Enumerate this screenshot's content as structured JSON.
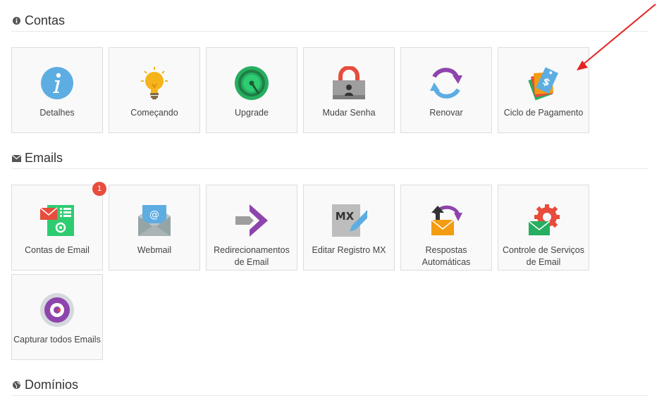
{
  "sections": {
    "contas": {
      "title": "Contas",
      "icon": "info-icon",
      "items": [
        {
          "label": "Detalhes",
          "icon": "info-circle-icon"
        },
        {
          "label": "Começando",
          "icon": "lightbulb-icon"
        },
        {
          "label": "Upgrade",
          "icon": "speedometer-icon"
        },
        {
          "label": "Mudar Senha",
          "icon": "padlock-icon"
        },
        {
          "label": "Renovar",
          "icon": "renew-arrows-icon"
        },
        {
          "label": "Ciclo de Pagamento",
          "icon": "price-tags-icon"
        }
      ]
    },
    "emails": {
      "title": "Emails",
      "icon": "envelope-icon",
      "items": [
        {
          "label": "Contas de Email",
          "icon": "email-accounts-icon",
          "badge": "1"
        },
        {
          "label": "Webmail",
          "icon": "webmail-icon"
        },
        {
          "label": "Redirecionamentos de Email",
          "icon": "forward-arrow-icon"
        },
        {
          "label": "Editar Registro MX",
          "icon": "mx-record-icon"
        },
        {
          "label": "Respostas Automáticas",
          "icon": "autoresponder-icon"
        },
        {
          "label": "Controle de Serviços de Email",
          "icon": "email-services-gear-icon"
        },
        {
          "label": "Capturar todos Emails",
          "icon": "catch-all-icon"
        }
      ]
    },
    "dominios": {
      "title": "Domínios",
      "icon": "globe-icon"
    }
  },
  "colors": {
    "accent_blue": "#5dade2",
    "badge_red": "#e74c3c",
    "annotation_arrow": "#e32222"
  }
}
